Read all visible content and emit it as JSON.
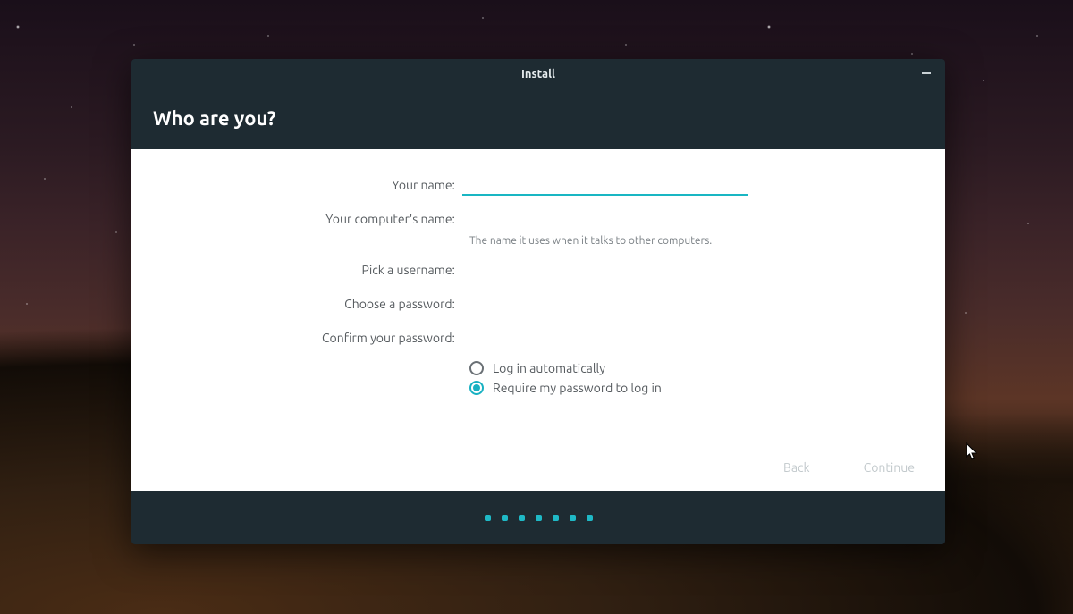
{
  "colors": {
    "accent": "#18b1c2",
    "header_bg": "#1e2b32"
  },
  "window": {
    "title": "Install",
    "heading": "Who are you?"
  },
  "form": {
    "your_name_label": "Your name:",
    "your_name_value": "",
    "computer_name_label": "Your computer's name:",
    "computer_name_value": "",
    "computer_name_hint": "The name it uses when it talks to other computers.",
    "username_label": "Pick a username:",
    "username_value": "",
    "password_label": "Choose a password:",
    "password_value": "",
    "confirm_password_label": "Confirm your password:",
    "confirm_password_value": ""
  },
  "login_options": {
    "auto_label": "Log in automatically",
    "require_label": "Require my password to log in",
    "selected": "require"
  },
  "buttons": {
    "back": "Back",
    "continue": "Continue"
  },
  "progress": {
    "total": 7,
    "current": 7
  }
}
